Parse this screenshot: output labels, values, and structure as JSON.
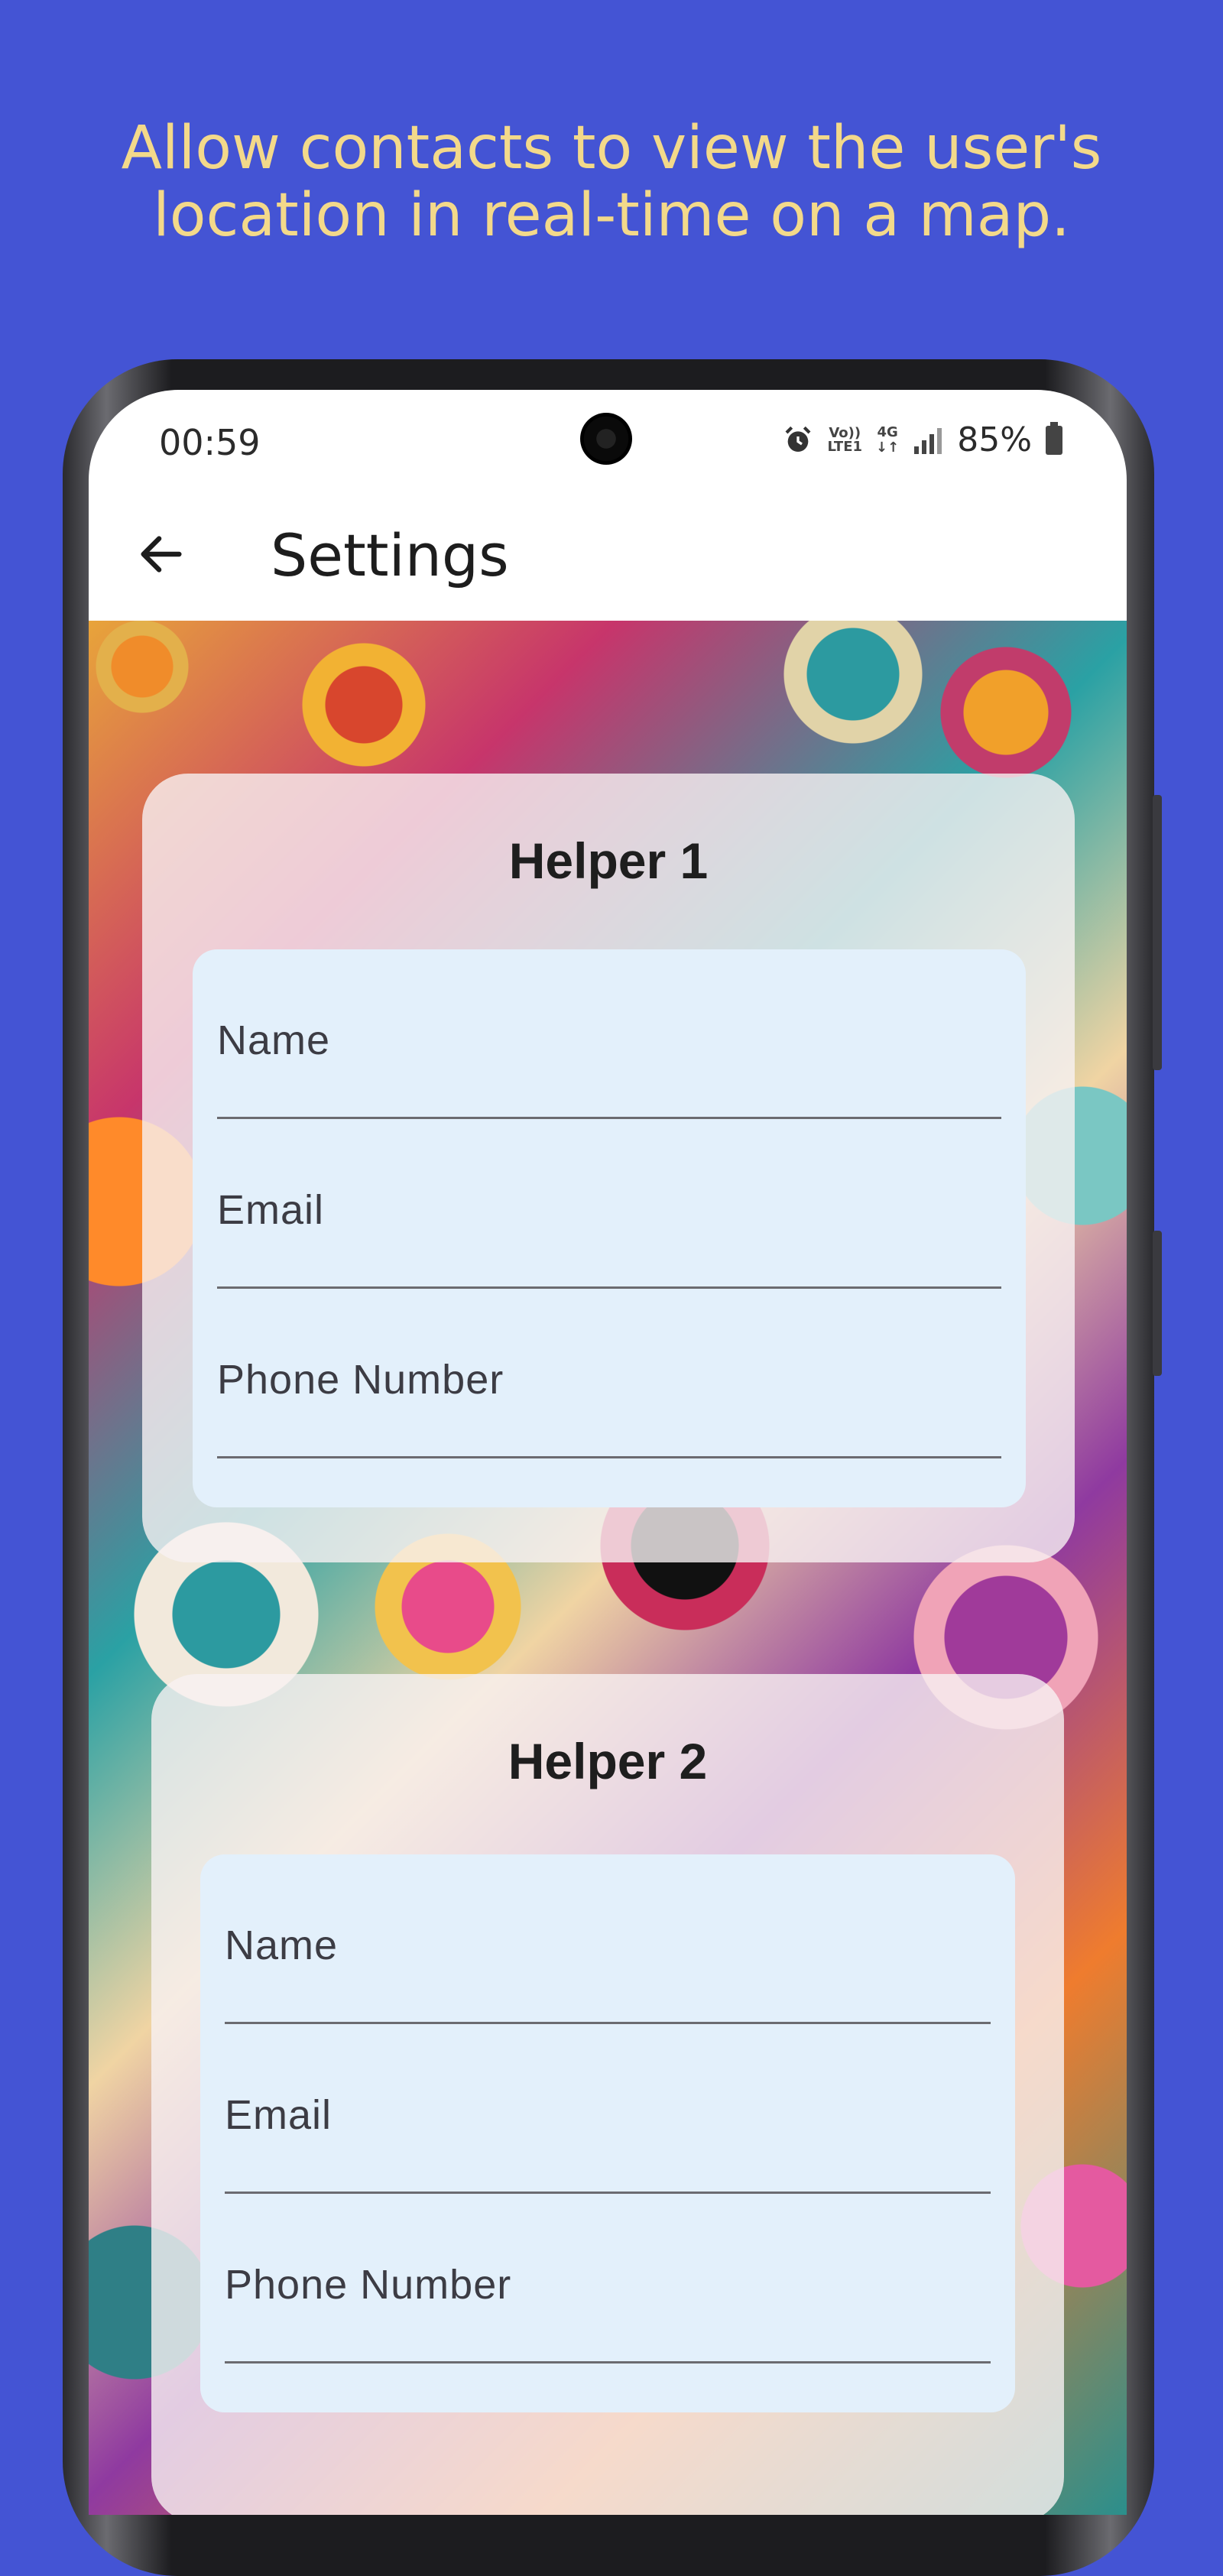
{
  "caption": {
    "line1": "Allow contacts to view the user's",
    "line2": "location in real-time on a map."
  },
  "status_bar": {
    "time": "00:59",
    "volte_top": "Vo))",
    "volte_bottom": "LTE1",
    "network_top": "4G",
    "network_bottom": "↓↑",
    "battery": "85%"
  },
  "app_bar": {
    "title": "Settings"
  },
  "helpers": [
    {
      "title": "Helper 1",
      "fields": [
        {
          "label": "Name"
        },
        {
          "label": "Email"
        },
        {
          "label": "Phone Number"
        }
      ]
    },
    {
      "title": "Helper 2",
      "fields": [
        {
          "label": "Name"
        },
        {
          "label": "Email"
        },
        {
          "label": "Phone Number"
        }
      ]
    }
  ],
  "colors": {
    "page_background": "#4454d4",
    "caption_text": "#f3d98a",
    "field_background": "#e3f0fb"
  }
}
